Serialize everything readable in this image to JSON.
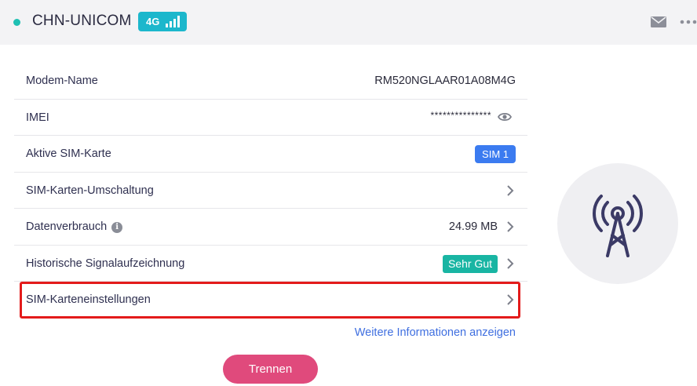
{
  "header": {
    "carrier": "CHN-UNICOM",
    "network_type": "4G",
    "status_color": "#1ec0b3",
    "icons": [
      "status-dot",
      "signal-bars-icon",
      "mail-icon",
      "more-icon"
    ]
  },
  "info": {
    "rows": [
      {
        "label": "Modem-Name",
        "value": "RM520NGLAAR01A08M4G"
      },
      {
        "label": "IMEI",
        "value": "***************"
      },
      {
        "label": "Aktive SIM-Karte",
        "value": "SIM 1"
      },
      {
        "label": "SIM-Karten-Umschaltung"
      },
      {
        "label": "Datenverbrauch",
        "value": "24.99 MB"
      },
      {
        "label": "Historische Signalaufzeichnung",
        "value": "Sehr Gut"
      },
      {
        "label": "SIM-Karteneinstellungen"
      }
    ]
  },
  "more_link": "Weitere Informationen anzeigen",
  "disconnect_label": "Trennen",
  "colors": {
    "accent": "#1cb7cc",
    "sim_badge": "#3b7bf0",
    "signal_badge": "#19b5a3",
    "disconnect": "#e04a7c",
    "highlight": "#e31b1b",
    "link": "#3f6fe0"
  },
  "illustration": "cell-tower-icon"
}
